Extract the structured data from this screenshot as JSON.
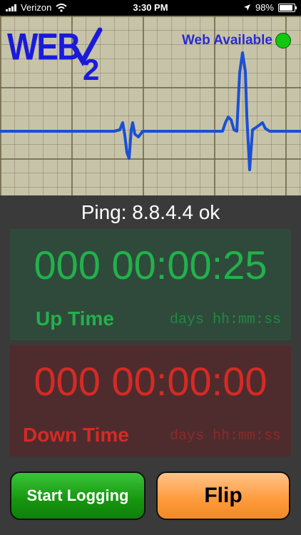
{
  "status_bar": {
    "carrier": "Verizon",
    "time": "3:30 PM",
    "battery": "98%",
    "battery_level": 0.98
  },
  "header": {
    "logo_text": "WEB",
    "logo_sub": "2",
    "web_status": "Web Available",
    "web_status_color": "#0fc80f"
  },
  "ping_text": "Ping: 8.8.4.4 ok",
  "up": {
    "counter": "000 00:00:25",
    "label": "Up Time",
    "units": "days hh:mm:ss"
  },
  "down": {
    "counter": "000 00:00:00",
    "label": "Down Time",
    "units": "days hh:mm:ss"
  },
  "buttons": {
    "start": "Start Logging",
    "flip": "Flip"
  },
  "colors": {
    "up": "#22b14c",
    "down": "#d62a24",
    "ecg_line": "#1a4fd6"
  }
}
